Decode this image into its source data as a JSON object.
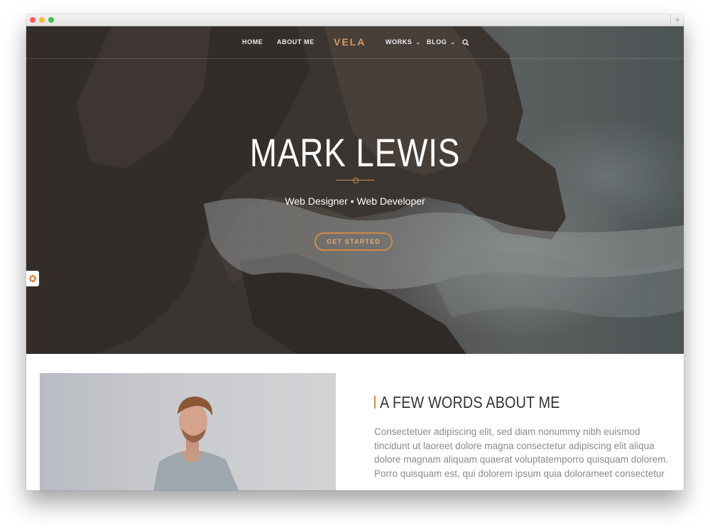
{
  "nav": {
    "items": [
      {
        "label": "HOME"
      },
      {
        "label": "ABOUT ME"
      },
      {
        "label": "WORKS"
      },
      {
        "label": "BLOG"
      }
    ],
    "logo": "VELA"
  },
  "hero": {
    "title": "MARK LEWIS",
    "subtitle": "Web Designer • Web Developer",
    "cta_label": "GET STARTED"
  },
  "about": {
    "heading": "A FEW WORDS ABOUT ME",
    "paragraph1": "Consectetuer adipiscing elit, sed diam nonummy nibh euismod tincidunt ut laoreet dolore magna consectetur adipiscing elit aliqua dolore magnam aliquam quaerat voluptatemporro quisquam dolorem.",
    "paragraph2": "Porro quisquam est, qui dolorem ipsum quia dolorameet consectetur"
  },
  "colors": {
    "accent": "#d08a45",
    "logo": "#d39a58"
  },
  "icons": {
    "search": "search-icon",
    "settings": "gear-icon",
    "dropdown": "chevron-down-icon"
  }
}
